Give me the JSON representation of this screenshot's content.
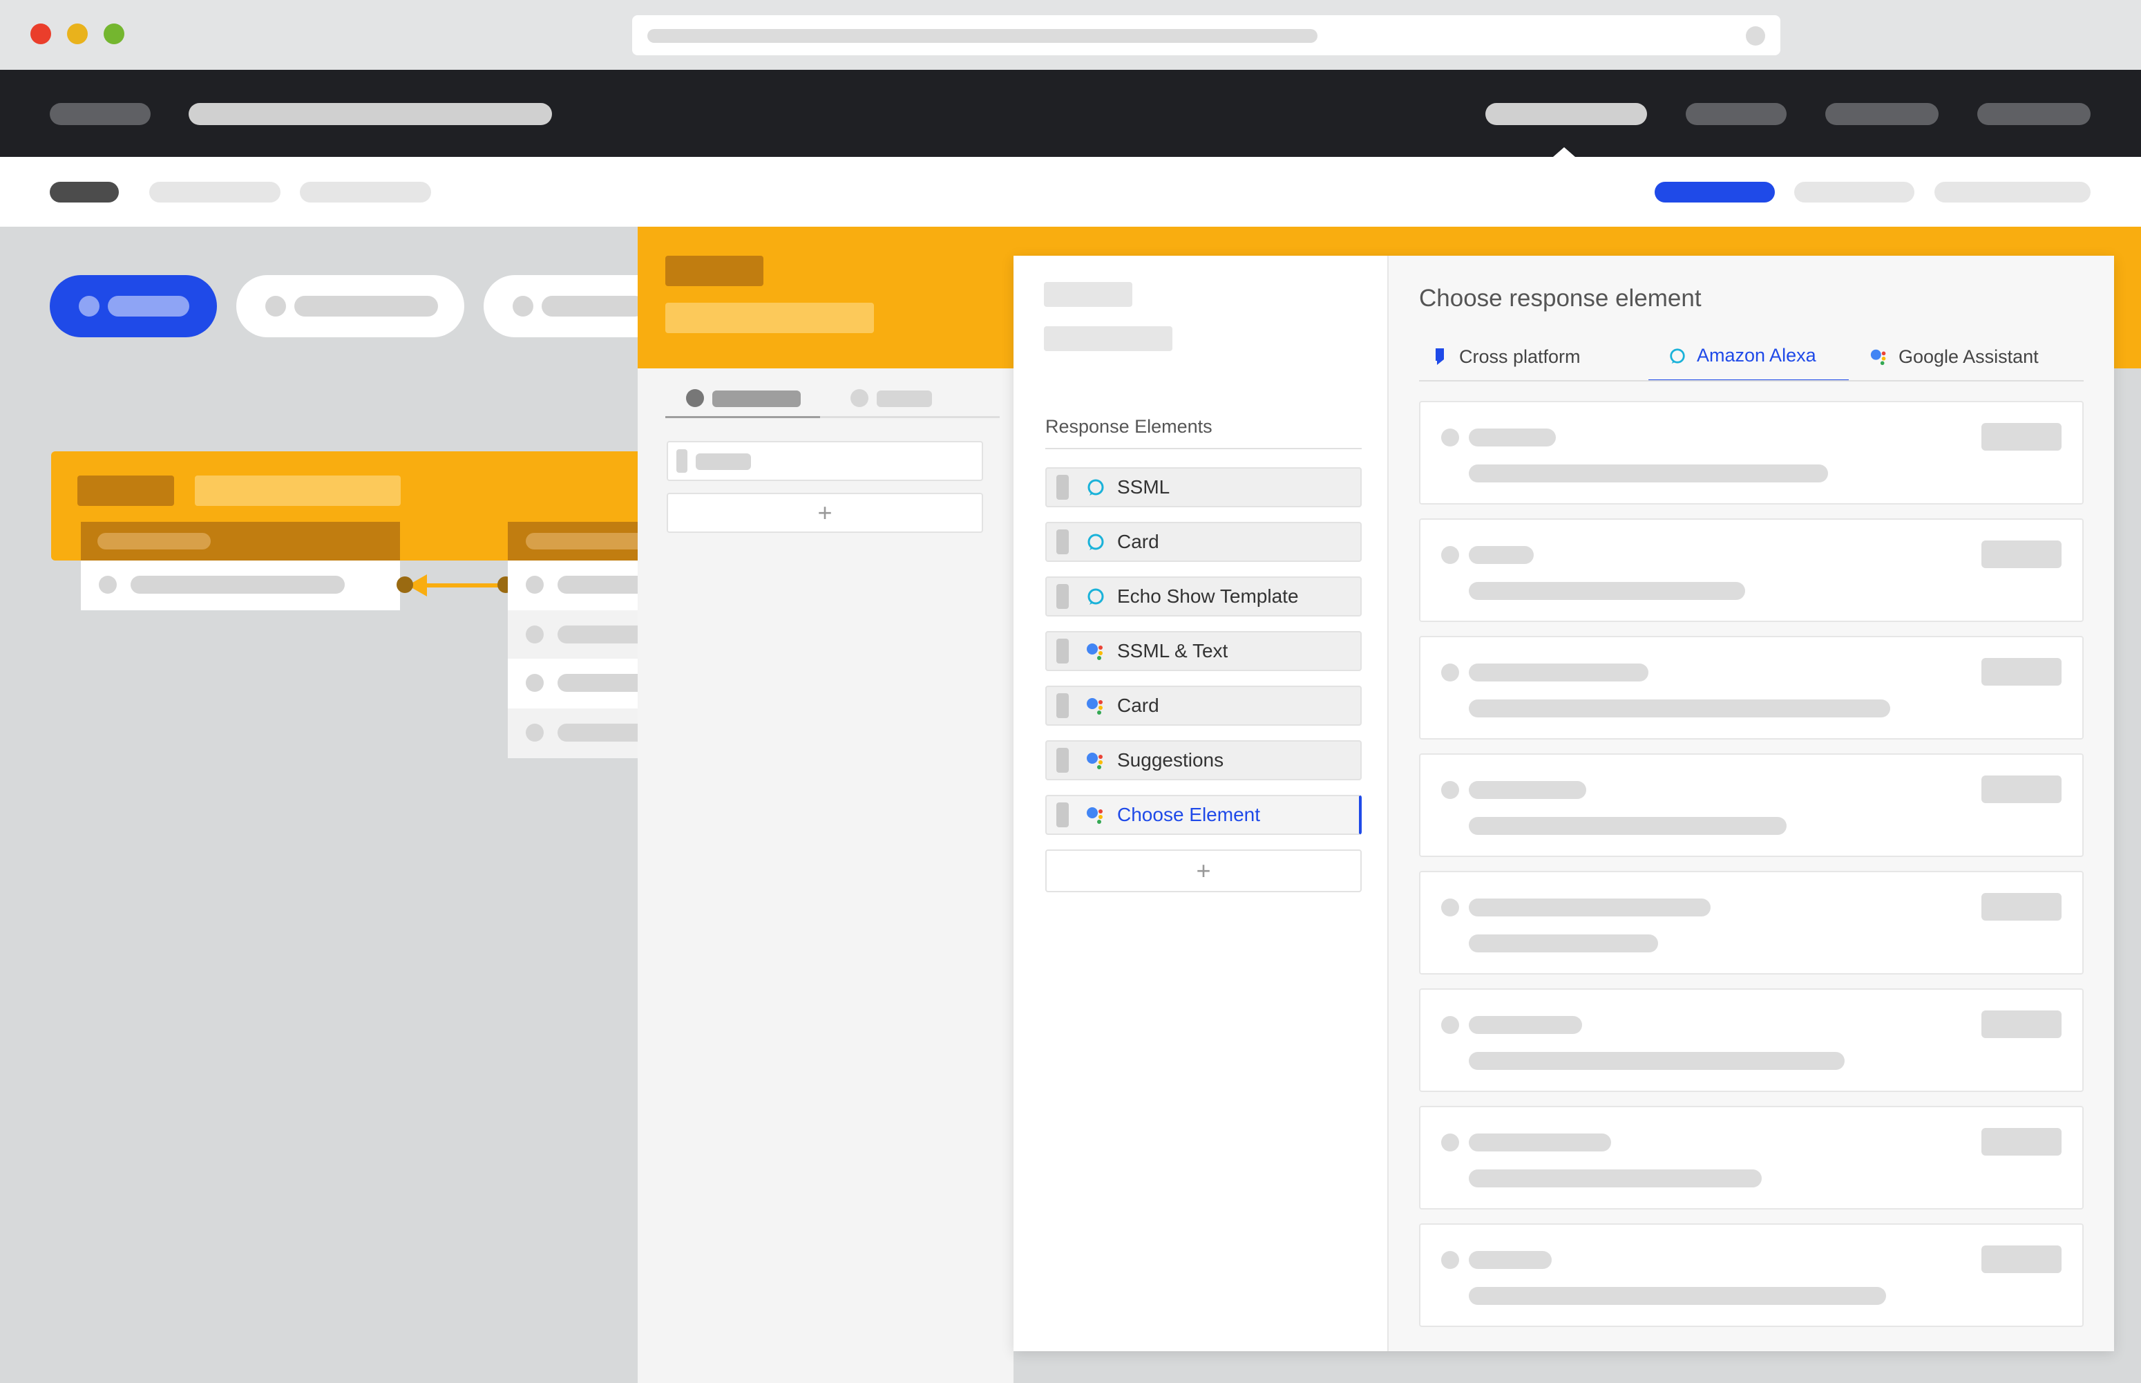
{
  "editor": {
    "section_title": "Response Elements",
    "elements": [
      {
        "label": "SSML",
        "platform": "alexa",
        "icon": "alexa-icon"
      },
      {
        "label": "Card",
        "platform": "alexa",
        "icon": "alexa-icon"
      },
      {
        "label": "Echo Show Template",
        "platform": "alexa",
        "icon": "alexa-icon"
      },
      {
        "label": "SSML & Text",
        "platform": "google",
        "icon": "google-assistant-icon"
      },
      {
        "label": "Card",
        "platform": "google",
        "icon": "google-assistant-icon"
      },
      {
        "label": "Suggestions",
        "platform": "google",
        "icon": "google-assistant-icon"
      },
      {
        "label": "Choose Element",
        "platform": "google",
        "icon": "google-assistant-icon",
        "active": true
      }
    ],
    "add_label": "+"
  },
  "chooser": {
    "title": "Choose response element",
    "tabs": [
      {
        "label": "Cross platform",
        "icon": "cross-platform-icon"
      },
      {
        "label": "Amazon Alexa",
        "icon": "alexa-icon",
        "active": true
      },
      {
        "label": "Google Assistant",
        "icon": "google-assistant-icon"
      }
    ]
  },
  "middle": {
    "add_label": "+"
  },
  "colors": {
    "accent": "#1f4ae8",
    "orange": "#f9ad10",
    "alexa": "#1ab2d9",
    "google_blue": "#4285f4",
    "google_red": "#ea4335",
    "google_yellow": "#fbbc05",
    "google_green": "#34a853"
  }
}
